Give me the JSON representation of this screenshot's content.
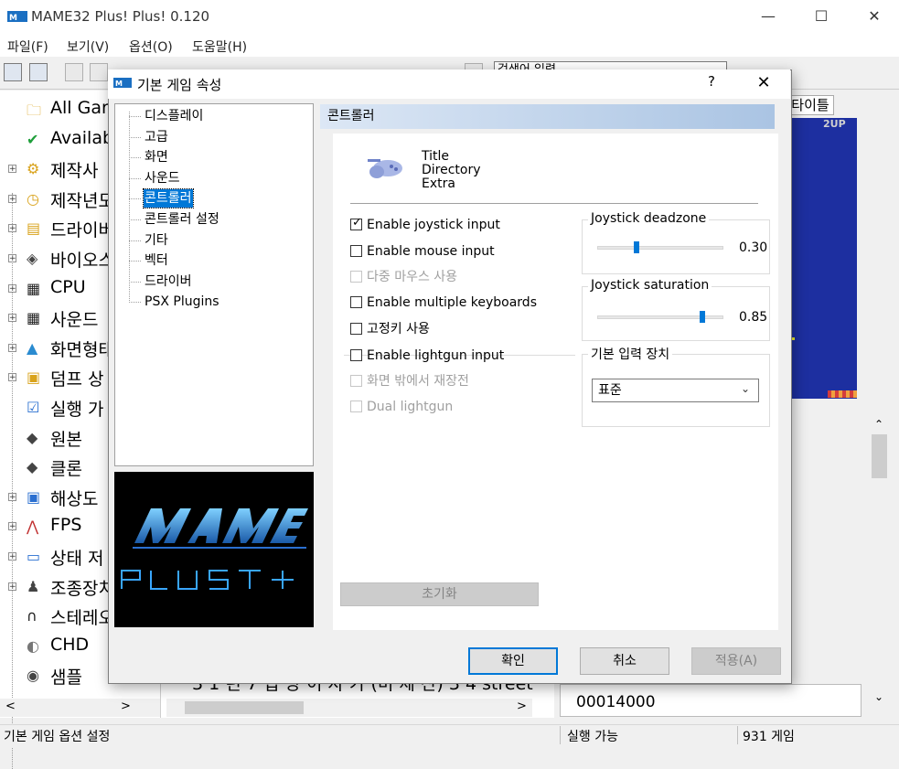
{
  "window": {
    "title": "MAME32 Plus! Plus! 0.120",
    "minimize_glyph": "—",
    "maximize_glyph": "☐",
    "close_glyph": "✕"
  },
  "menu": [
    "파일(F)",
    "보기(V)",
    "옵션(O)",
    "도움말(H)"
  ],
  "search": {
    "value": "검색어 입력"
  },
  "tree": [
    {
      "label": "All Gar",
      "expand": "",
      "icon": "folder-icon"
    },
    {
      "label": "Availab",
      "expand": "",
      "icon": "check-circle-icon"
    },
    {
      "label": "제작사",
      "expand": "+",
      "icon": "folder-gear-icon"
    },
    {
      "label": "제작년도",
      "expand": "+",
      "icon": "folder-clock-icon"
    },
    {
      "label": "드라이버",
      "expand": "+",
      "icon": "folder-document-icon"
    },
    {
      "label": "바이오스",
      "expand": "+",
      "icon": "chip-icon"
    },
    {
      "label": "CPU",
      "expand": "+",
      "icon": "cpu-icon"
    },
    {
      "label": "사운드",
      "expand": "+",
      "icon": "sound-chip-icon"
    },
    {
      "label": "화면형태",
      "expand": "+",
      "icon": "screen-mountain-icon"
    },
    {
      "label": "덤프 상",
      "expand": "+",
      "icon": "folder-dump-icon"
    },
    {
      "label": "실행 가",
      "expand": "",
      "icon": "folder-check-icon"
    },
    {
      "label": "원본",
      "expand": "",
      "icon": "cartridge-icon"
    },
    {
      "label": "클론",
      "expand": "",
      "icon": "cartridge-icon"
    },
    {
      "label": "해상도",
      "expand": "+",
      "icon": "monitor-icon"
    },
    {
      "label": "FPS",
      "expand": "+",
      "icon": "graph-icon"
    },
    {
      "label": "상태 저",
      "expand": "+",
      "icon": "floppy-icon"
    },
    {
      "label": "조종장치",
      "expand": "+",
      "icon": "joystick-icon"
    },
    {
      "label": "스테레오",
      "expand": "",
      "icon": "headphones-icon"
    },
    {
      "label": "CHD",
      "expand": "",
      "icon": "disc-drive-icon"
    },
    {
      "label": "샘플",
      "expand": "",
      "icon": "speaker-icon"
    }
  ],
  "middle": {
    "row_text": "3 1 년 7    입 당 이 자 가 (미 제 산)        3 4 street"
  },
  "right": {
    "tab_label": "타이틀",
    "screen_text": "2UP",
    "bottom_code": "00014000"
  },
  "status": {
    "left": "기본 게임 옵션 설정",
    "middle": "실행 가능",
    "right": "931 게임"
  },
  "dialog": {
    "title": "기본 게임 속성",
    "help_glyph": "?",
    "close_glyph": "✕",
    "nav": [
      "디스플레이",
      "고급",
      "화면",
      "사운드",
      "콘트롤러",
      "콘트롤러 설정",
      "기타",
      "벡터",
      "드라이버",
      "PSX Plugins"
    ],
    "selected_nav": 4,
    "page_title": "콘트롤러",
    "info": [
      "Title",
      "Directory",
      "Extra"
    ],
    "checkboxes": [
      {
        "label": "Enable joystick input",
        "checked": true,
        "enabled": true
      },
      {
        "label": "Enable mouse input",
        "checked": false,
        "enabled": true
      },
      {
        "label": "다중 마우스 사용",
        "checked": false,
        "enabled": false
      },
      {
        "label": "Enable multiple keyboards",
        "checked": false,
        "enabled": true
      },
      {
        "label": "고정키 사용",
        "checked": false,
        "enabled": true
      },
      {
        "label": "Enable lightgun input",
        "checked": false,
        "enabled": true
      },
      {
        "label": "화면 밖에서 재장전",
        "checked": false,
        "enabled": false
      },
      {
        "label": "Dual lightgun",
        "checked": false,
        "enabled": false
      }
    ],
    "deadzone": {
      "label": "Joystick deadzone",
      "value": "0.30",
      "level": 0.3
    },
    "saturation": {
      "label": "Joystick saturation",
      "value": "0.85",
      "level": 0.85
    },
    "input_device": {
      "label": "기본 입력 장치",
      "selected": "표준"
    },
    "reset_label": "초기화",
    "ok_label": "확인",
    "cancel_label": "취소",
    "apply_label": "적용(A)"
  },
  "colors": {
    "accent": "#0078d7",
    "game_screen": "#1d2fa0"
  }
}
